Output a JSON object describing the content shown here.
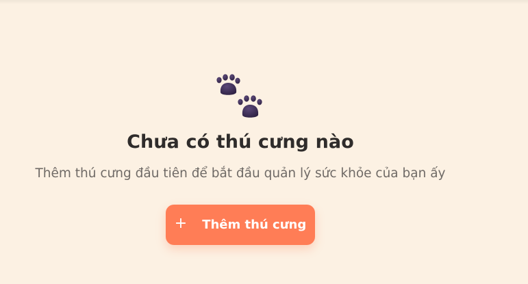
{
  "empty_state": {
    "icon": "paw-prints-icon",
    "title": "Chưa có thú cưng nào",
    "subtitle": "Thêm thú cưng đầu tiên để bắt đầu quản lý sức khỏe của bạn ấy",
    "add_button_label": "Thêm thú cưng",
    "add_button_icon": "plus-icon"
  },
  "colors": {
    "background": "#fcf1e3",
    "accent": "#ff7d56",
    "title_text": "#2f2c2b",
    "subtitle_text": "#6f6a66",
    "paw": "#3d2e55"
  }
}
